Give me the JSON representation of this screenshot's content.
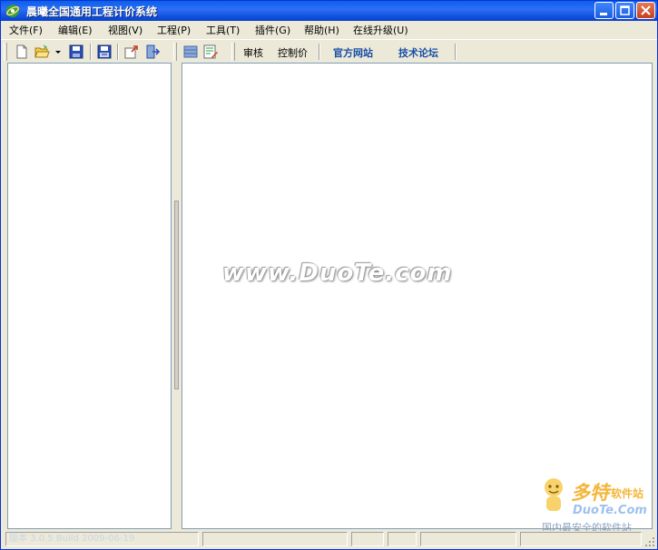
{
  "window": {
    "title": "晨曦全国通用工程计价系统"
  },
  "menubar": {
    "items": [
      {
        "label": "文件(F)"
      },
      {
        "label": "编辑(E)"
      },
      {
        "label": "视图(V)"
      },
      {
        "label": "工程(P)"
      },
      {
        "label": "工具(T)"
      },
      {
        "label": "插件(G)"
      },
      {
        "label": "帮助(H)"
      },
      {
        "label": "在线升级(U)"
      }
    ]
  },
  "toolbar": {
    "icons": [
      "new-file-icon",
      "open-folder-icon",
      "dropdown-arrow-icon",
      "save-icon",
      "save-as-icon",
      "export-icon",
      "exit-icon",
      "database-icon",
      "edit-sheet-icon"
    ],
    "audit_label": "审核",
    "control_price_label": "控制价",
    "official_site_label": "官方网站",
    "tech_forum_label": "技术论坛"
  },
  "watermark": {
    "text": "www.DuoTe.com"
  },
  "statusbar": {
    "version_text": "版本 3.0.5 Build 2009-06-19"
  },
  "logo": {
    "brand": "多特",
    "brand_sub": "软件站",
    "url": "DuoTe.Com",
    "slogan": "国内最安全的软件站"
  },
  "colors": {
    "titlebar": "#0a5fe8",
    "link": "#1a4fa6",
    "pane_border": "#7f9db9"
  }
}
